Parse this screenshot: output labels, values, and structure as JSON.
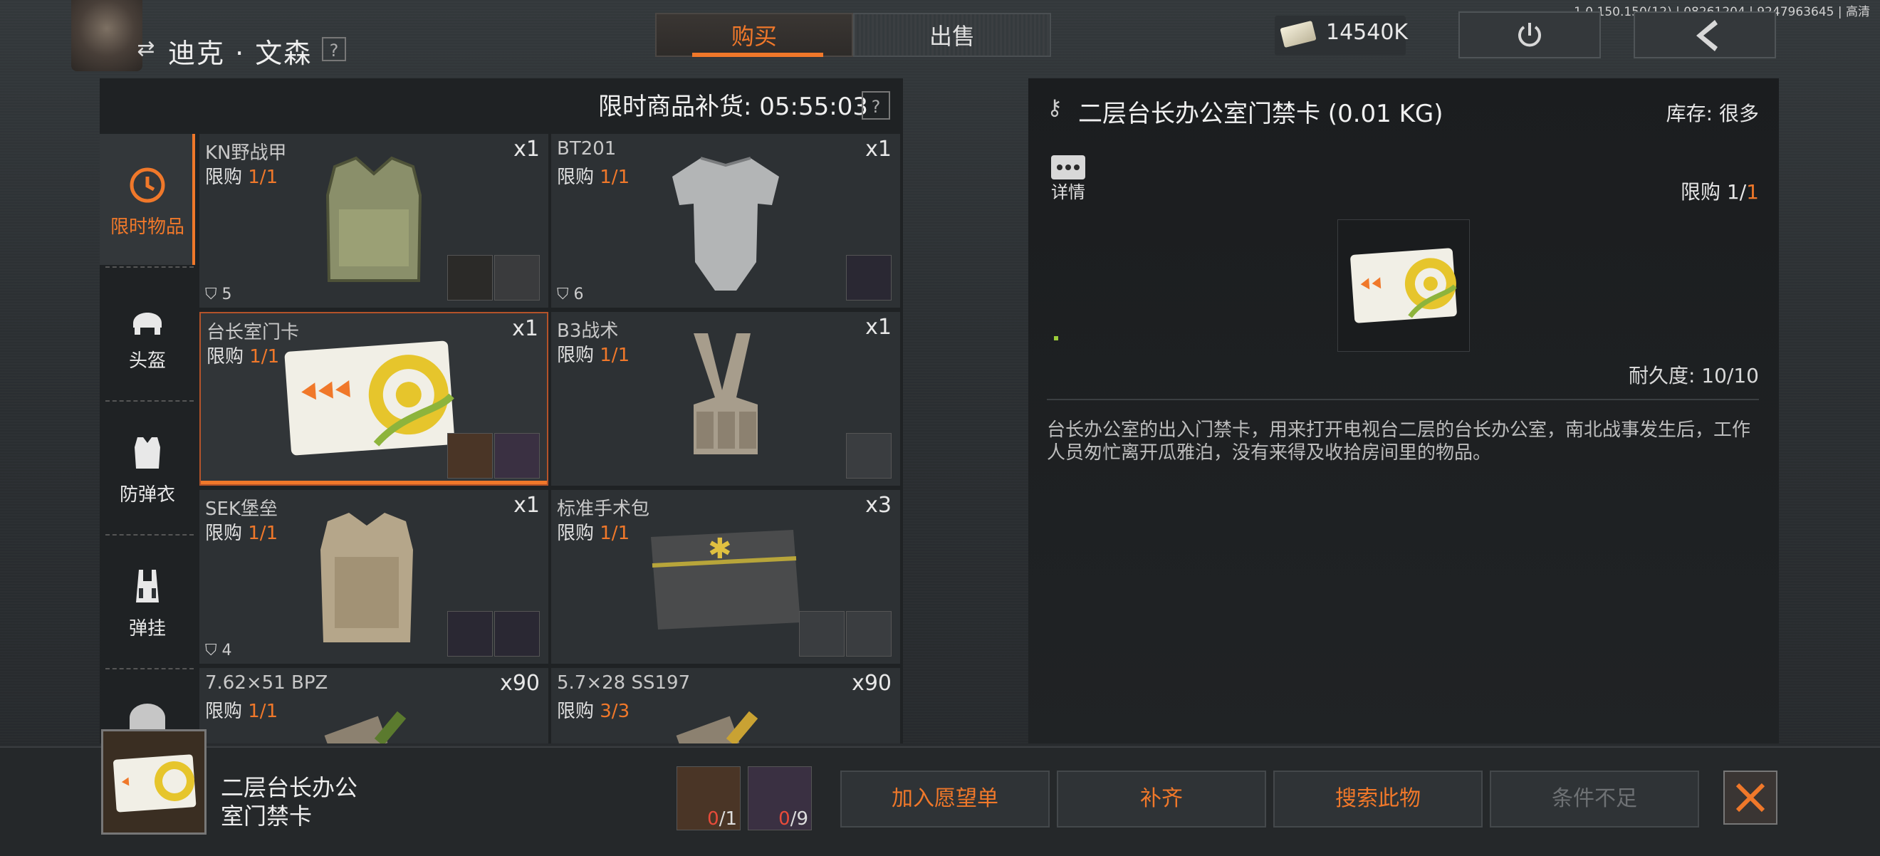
{
  "version": "1.0.150.150(12) | 08261204 | 9247963645 | 高清",
  "player": {
    "name": "迪克 · 文森",
    "help": "?"
  },
  "tabs": [
    {
      "label": "购买"
    },
    {
      "label": "出售"
    }
  ],
  "currency": {
    "amount": "14540K"
  },
  "shop": {
    "refresh_label": "限时商品补货: 05:55:03",
    "help": "?",
    "categories": [
      {
        "label": "限时物品",
        "icon": "clock-icon"
      },
      {
        "label": "头盔",
        "icon": "helmet-icon"
      },
      {
        "label": "防弹衣",
        "icon": "vest-icon"
      },
      {
        "label": "弹挂",
        "icon": "chest-rig-icon"
      }
    ],
    "items": [
      {
        "name": "KN野战甲",
        "limit_prefix": "限购 ",
        "limit": "1/1",
        "qty": "x1",
        "armor": "5"
      },
      {
        "name": "BT201",
        "limit_prefix": "限购 ",
        "limit": "1/1",
        "qty": "x1",
        "armor": "6"
      },
      {
        "name": "台长室门卡",
        "limit_prefix": "限购 ",
        "limit": "1/1",
        "qty": "x1"
      },
      {
        "name": "B3战术",
        "limit_prefix": "限购 ",
        "limit": "1/1",
        "qty": "x1"
      },
      {
        "name": "SEK堡垒",
        "limit_prefix": "限购 ",
        "limit": "1/1",
        "qty": "x1",
        "armor": "4"
      },
      {
        "name": "标准手术包",
        "limit_prefix": "限购 ",
        "limit": "1/1",
        "qty": "x3"
      },
      {
        "name": "7.62×51 BPZ",
        "limit_prefix": "限购 ",
        "limit": "1/1",
        "qty": "x90"
      },
      {
        "name": "5.7×28 SS197",
        "limit_prefix": "限购 ",
        "limit": "3/3",
        "qty": "x90"
      }
    ]
  },
  "detail": {
    "title": "二层台长办公室门禁卡 (0.01 KG)",
    "stock": "库存: 很多",
    "details_label": "详情",
    "limit_prefix": "限购 1/",
    "limit_value": "1",
    "durability": "耐久度: 10/10",
    "description": "台长办公室的出入门禁卡，用来打开电视台二层的台长办公室，南北战事发生后，工作人员匆忙离开瓜雅泊，没有来得及收拾房间里的物品。"
  },
  "bottom": {
    "item_name_line1": "二层台长办公",
    "item_name_line2": "室门禁卡",
    "requirements": [
      {
        "have": "0",
        "need": "/1"
      },
      {
        "have": "0",
        "need": "/9"
      }
    ],
    "buttons": {
      "wishlist": "加入愿望单",
      "fill": "补齐",
      "search": "搜索此物",
      "condition": "条件不足"
    }
  },
  "colors": {
    "accent": "#f0782a",
    "warn": "#e84b3a"
  }
}
